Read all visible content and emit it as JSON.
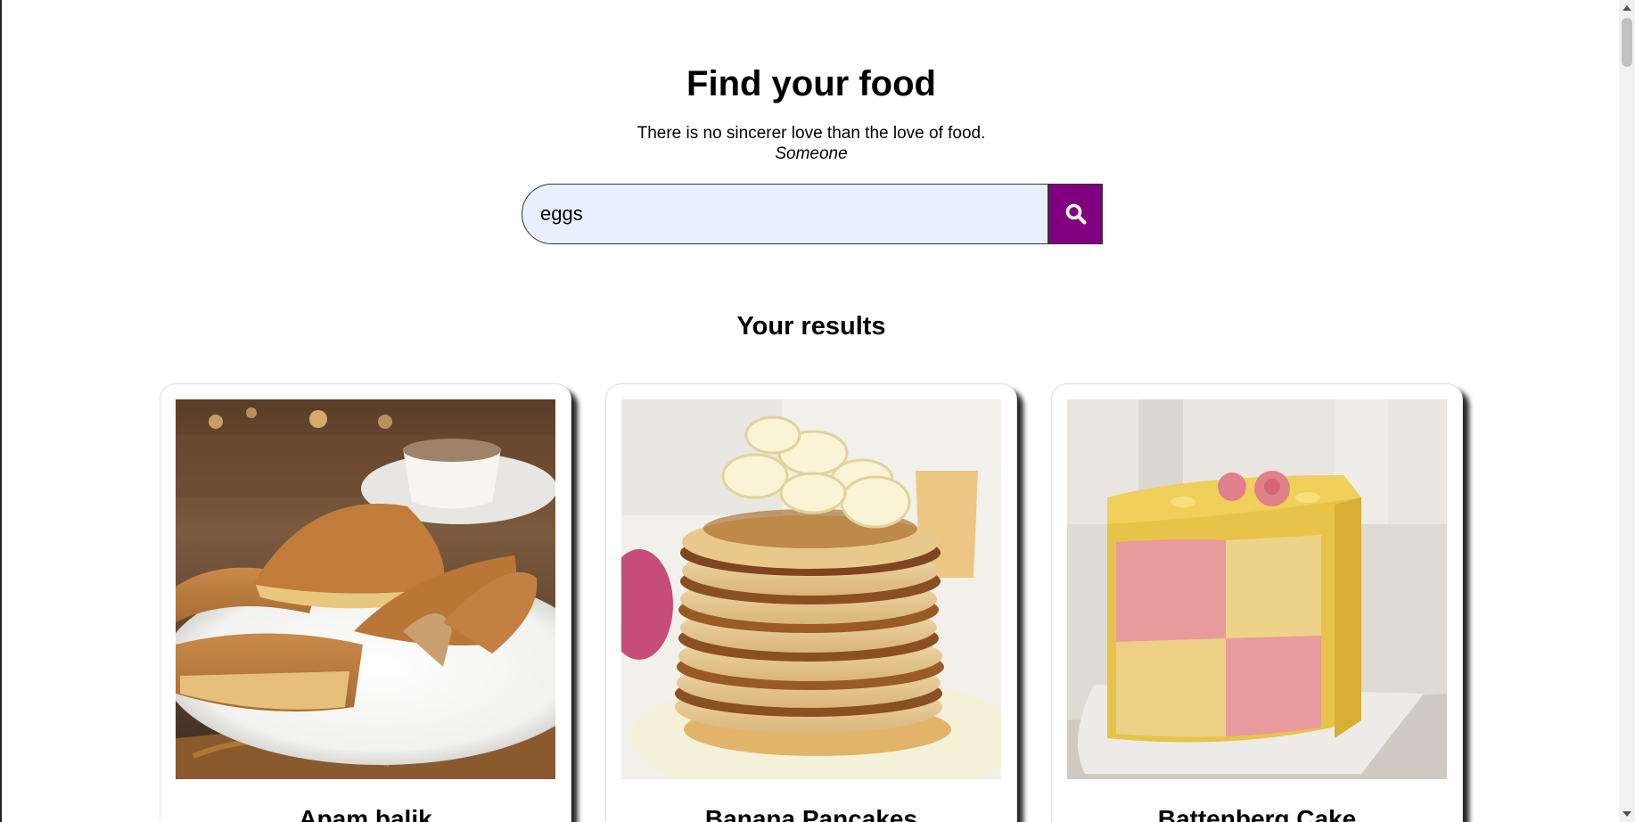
{
  "header": {
    "title": "Find your food",
    "quote": "There is no sincerer love than the love of food.",
    "author": "Someone"
  },
  "search": {
    "value": "eggs",
    "button_icon": "search-icon",
    "button_color": "#800080",
    "input_background": "#e8f0fe"
  },
  "results": {
    "title": "Your results",
    "items": [
      {
        "name": "Apam balik",
        "image": "apam-balik-photo"
      },
      {
        "name": "Banana Pancakes",
        "image": "banana-pancakes-photo"
      },
      {
        "name": "Battenberg Cake",
        "image": "battenberg-cake-photo"
      }
    ]
  }
}
